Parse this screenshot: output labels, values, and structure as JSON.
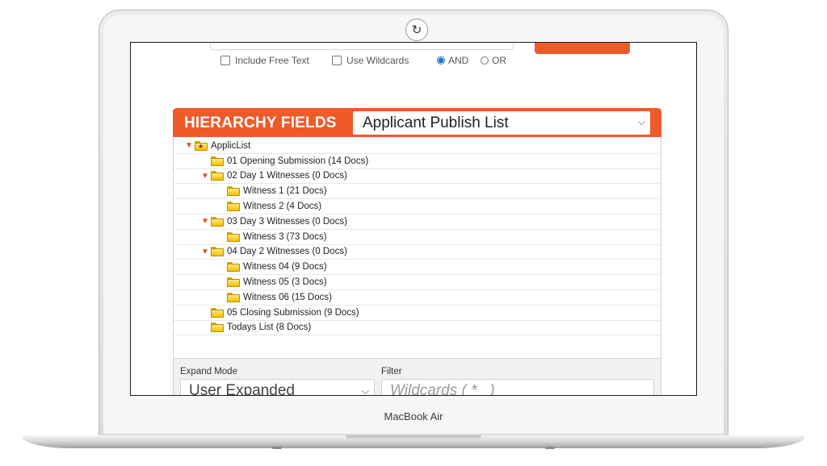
{
  "device": {
    "brand_label": "MacBook Air"
  },
  "search_options": {
    "include_free_text": "Include Free Text",
    "use_wildcards": "Use Wildcards",
    "and_label": "AND",
    "or_label": "OR"
  },
  "hierarchy": {
    "title": "HIERARCHY FIELDS",
    "selected_list": "Applicant Publish List",
    "tree": [
      {
        "label": "ApplicList",
        "level": 0,
        "expanded": true,
        "root": true
      },
      {
        "label": "01 Opening Submission (14 Docs)",
        "level": 1,
        "expanded": false
      },
      {
        "label": "02 Day 1 Witnesses (0 Docs)",
        "level": 1,
        "expanded": true
      },
      {
        "label": "Witness 1 (21 Docs)",
        "level": 2,
        "expanded": false
      },
      {
        "label": "Witness 2 (4 Docs)",
        "level": 2,
        "expanded": false
      },
      {
        "label": "03 Day 3 Witnesses (0 Docs)",
        "level": 1,
        "expanded": true
      },
      {
        "label": "Witness 3 (73 Docs)",
        "level": 2,
        "expanded": false
      },
      {
        "label": "04 Day 2 Witnesses (0 Docs)",
        "level": 1,
        "expanded": true
      },
      {
        "label": "Witness 04 (9 Docs)",
        "level": 2,
        "expanded": false
      },
      {
        "label": "Witness 05 (3 Docs)",
        "level": 2,
        "expanded": false
      },
      {
        "label": "Witness 06 (15 Docs)",
        "level": 2,
        "expanded": false
      },
      {
        "label": "05 Closing Submission (9 Docs)",
        "level": 1,
        "expanded": false
      },
      {
        "label": "Todays List (8 Docs)",
        "level": 1,
        "expanded": false
      }
    ]
  },
  "controls": {
    "expand_mode_label": "Expand Mode",
    "expand_mode_value": "User Expanded",
    "filter_label": "Filter",
    "filter_placeholder": "Wildcards ( *_ )"
  },
  "colors": {
    "accent": "#ef5a29",
    "folder": "#f4c200",
    "radio_selected": "#1e72d6"
  }
}
